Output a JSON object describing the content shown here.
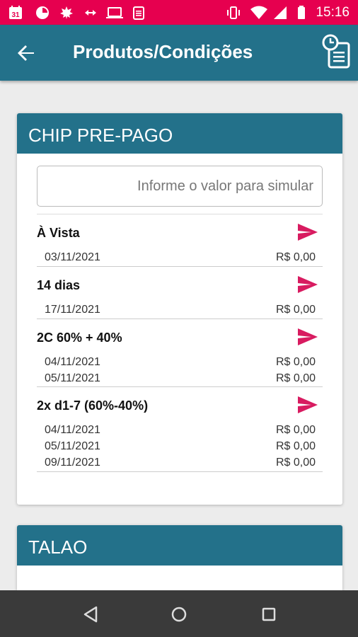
{
  "status_bar": {
    "time": "15:16",
    "left_icons": [
      "calendar-icon",
      "pie-icon",
      "maple-leaf-icon",
      "arrows-icon",
      "laptop-icon",
      "clipboard-icon"
    ],
    "right_icons": [
      "vibrate-icon",
      "wifi-icon",
      "signal-icon",
      "battery-icon"
    ],
    "calendar_day": "31"
  },
  "app_bar": {
    "title": "Produtos/Condições",
    "back_icon": "arrow-left-icon",
    "action_icon": "history-document-icon"
  },
  "colors": {
    "status_bar": "#e6004f",
    "app_bar": "#23718a",
    "accent": "#d81b60",
    "nav_bar": "#3a3a3a"
  },
  "products": [
    {
      "title": "CHIP PRE-PAGO",
      "input_placeholder": "Informe o valor para simular",
      "input_value": "",
      "conditions": [
        {
          "name": "À Vista",
          "installments": [
            {
              "date": "03/11/2021",
              "value": "R$ 0,00"
            }
          ]
        },
        {
          "name": "14 dias",
          "installments": [
            {
              "date": "17/11/2021",
              "value": "R$ 0,00"
            }
          ]
        },
        {
          "name": "2C 60% + 40%",
          "installments": [
            {
              "date": "04/11/2021",
              "value": "R$ 0,00"
            },
            {
              "date": "05/11/2021",
              "value": "R$ 0,00"
            }
          ]
        },
        {
          "name": "2x d1-7 (60%-40%)",
          "installments": [
            {
              "date": "04/11/2021",
              "value": "R$ 0,00"
            },
            {
              "date": "05/11/2021",
              "value": "R$ 0,00"
            },
            {
              "date": "09/11/2021",
              "value": "R$ 0,00"
            }
          ]
        }
      ]
    },
    {
      "title": "TALAO"
    }
  ],
  "nav_bar": [
    "back-triangle-icon",
    "home-circle-icon",
    "recents-square-icon"
  ]
}
